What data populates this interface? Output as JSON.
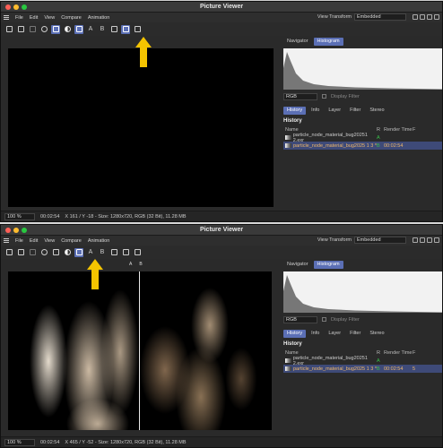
{
  "window_title": "Picture Viewer",
  "menu": [
    "File",
    "Edit",
    "View",
    "Compare",
    "Animation"
  ],
  "view_transform": {
    "label": "View Transform",
    "value": "Embedded"
  },
  "toolbar": {
    "a_label": "A",
    "b_label": "B"
  },
  "ab_markers": {
    "a": "A",
    "b": "B"
  },
  "right_panel": {
    "tabs": [
      "Navigator",
      "Histogram"
    ],
    "channel": "RGB",
    "display_filter": "Display Filter",
    "history_tabs": [
      "History",
      "Info",
      "Layer",
      "Filter",
      "Stereo"
    ],
    "history_title": "History",
    "columns": {
      "name": "Name",
      "r": "R",
      "render_time": "Render Time",
      "f": "F"
    }
  },
  "screen1": {
    "history_rows": [
      {
        "name": "particle_node_material_bug20251 2.exr",
        "r": "A",
        "time": "",
        "f": ""
      },
      {
        "name": "particle_node_material_bug2025 1 3 *",
        "r": "B",
        "time": "00:02:54",
        "f": ""
      }
    ],
    "status": {
      "zoom": "100 %",
      "time": "00:02:54",
      "info": "X 161 / Y -18 - Size: 1280x720, RGB (32 Bit), 11.28 MB"
    }
  },
  "screen2": {
    "history_rows": [
      {
        "name": "particle_node_material_bug20251 2.exr",
        "r": "A",
        "time": "",
        "f": ""
      },
      {
        "name": "particle_node_material_bug2025 1 3 *",
        "r": "B",
        "time": "00:02:54",
        "f": "5"
      }
    ],
    "status": {
      "zoom": "100 %",
      "time": "00:02:54",
      "info": "X 465 / Y -52 - Size: 1280x720, RGB (32 Bit), 11.28 MB"
    }
  },
  "colors": {
    "accent": "#5b6fb5",
    "arrow": "#f5c400",
    "selected_row": "#3e4a78"
  }
}
